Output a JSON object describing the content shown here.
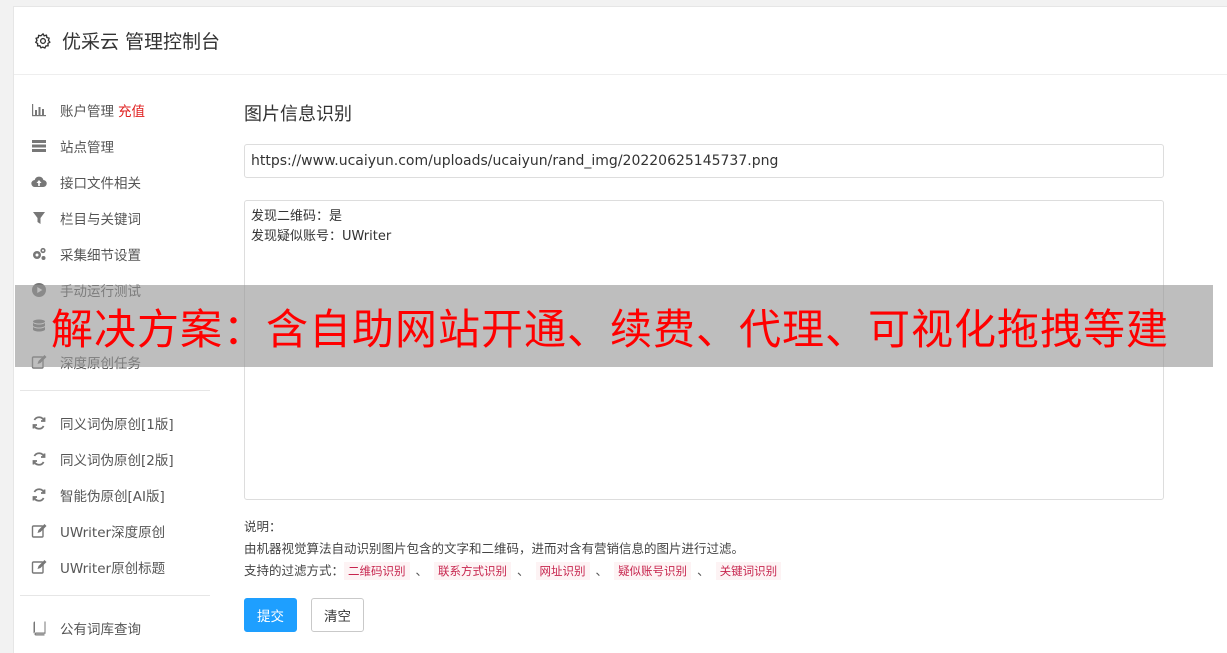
{
  "header": {
    "title": "优采云 管理控制台",
    "icon": "gear-icon"
  },
  "sidebar": {
    "group1": [
      {
        "label": "账户管理",
        "badge": "充值",
        "icon": "bar-chart-icon"
      },
      {
        "label": "站点管理",
        "icon": "server-icon"
      },
      {
        "label": "接口文件相关",
        "icon": "cloud-upload-icon"
      },
      {
        "label": "栏目与关键词",
        "icon": "filter-icon"
      },
      {
        "label": "采集细节设置",
        "icon": "cogs-icon"
      },
      {
        "label": "手动运行测试",
        "icon": "play-circle-icon"
      },
      {
        "label": "",
        "icon": "database-icon"
      },
      {
        "label": "深度原创任务",
        "icon": "edit-icon"
      }
    ],
    "group2": [
      {
        "label": "同义词伪原创[1版]",
        "icon": "refresh-icon"
      },
      {
        "label": "同义词伪原创[2版]",
        "icon": "refresh-icon"
      },
      {
        "label": "智能伪原创[AI版]",
        "icon": "refresh-icon"
      },
      {
        "label": "UWriter深度原创",
        "icon": "edit-icon"
      },
      {
        "label": "UWriter原创标题",
        "icon": "edit-icon"
      }
    ],
    "group3": [
      {
        "label": "公有词库查询",
        "icon": "book-icon"
      }
    ]
  },
  "main": {
    "title": "图片信息识别",
    "url_value": "https://www.ucaiyun.com/uploads/ucaiyun/rand_img/20220625145737.png",
    "result_text": "发现二维码：是\n发现疑似账号：UWriter",
    "notes_label": "说明：",
    "notes_desc": "由机器视觉算法自动识别图片包含的文字和二维码，进而对含有营销信息的图片进行过滤。",
    "filter_label": "支持的过滤方式：",
    "filter_tags": [
      "二维码识别",
      "联系方式识别",
      "网址识别",
      "疑似账号识别",
      "关键词识别"
    ],
    "filter_sep": "、",
    "submit_label": "提交",
    "clear_label": "清空"
  },
  "overlay": {
    "text": "解决方案：含自助网站开通、续费、代理、可视化拖拽等建"
  },
  "colors": {
    "primary": "#1e9fff",
    "badge": "#e02020",
    "tag_text": "#c7254e",
    "overlay_text": "#ff0000"
  }
}
